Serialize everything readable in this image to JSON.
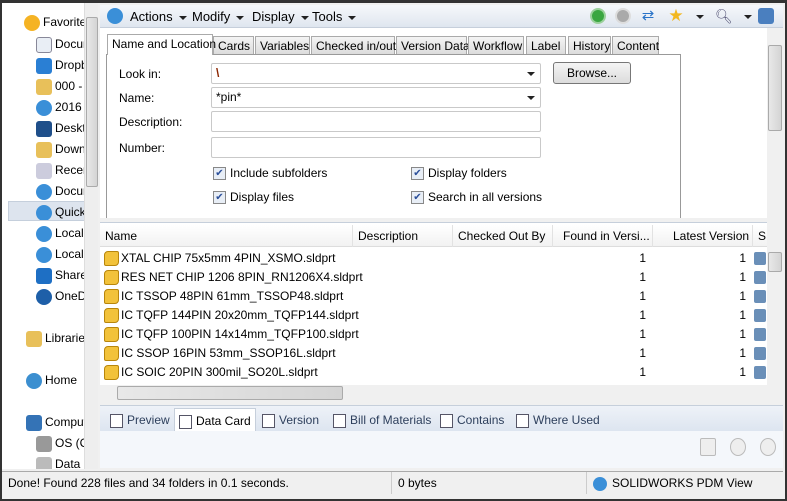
{
  "nav": {
    "items": [
      "Favorites",
      "Documents",
      "Dropbox",
      "000 -",
      "2016",
      "Desktop",
      "Downloads",
      "Recent",
      "Documents",
      "Quick",
      "Local",
      "Local",
      "SharePoint",
      "OneDrive",
      "Libraries",
      "Home",
      "Computer",
      "OS (C:)",
      "Data"
    ],
    "selected": "Quick"
  },
  "toolbar": {
    "menus": [
      "Actions",
      "Modify",
      "Display",
      "Tools"
    ],
    "icons": [
      "start-search-icon",
      "stop-search-icon",
      "refresh-icon",
      "favorites-star-icon",
      "search-zoom-icon",
      "pdm-help-icon"
    ]
  },
  "search": {
    "tabs": [
      "Name and Location",
      "Cards",
      "Variables",
      "Checked in/out",
      "Version Data",
      "Workflow",
      "Label",
      "History",
      "Content"
    ],
    "active_tab": "Name and Location",
    "look_in_label": "Look in:",
    "look_in_value": "\\",
    "name_label": "Name:",
    "name_value": "*pin*",
    "description_label": "Description:",
    "description_value": "",
    "number_label": "Number:",
    "number_value": "",
    "browse_label": "Browse...",
    "include_subfolders": {
      "label": "Include subfolders",
      "checked": true
    },
    "display_files": {
      "label": "Display files",
      "checked": true
    },
    "display_folders": {
      "label": "Display folders",
      "checked": true
    },
    "search_all_versions": {
      "label": "Search in all versions",
      "checked": true
    }
  },
  "list": {
    "columns": [
      "Name",
      "Description",
      "Checked Out By",
      "Found in Versi...",
      "Latest Version",
      "S"
    ],
    "rows": [
      {
        "name": "XTAL CHIP 75x5mm 4PIN_XSMO.sldprt",
        "found": "1",
        "latest": "1"
      },
      {
        "name": "RES NET CHIP 1206 8PIN_RN1206X4.sldprt",
        "found": "1",
        "latest": "1"
      },
      {
        "name": "IC TSSOP 48PIN 61mm_TSSOP48.sldprt",
        "found": "1",
        "latest": "1"
      },
      {
        "name": "IC TQFP 144PIN 20x20mm_TQFP144.sldprt",
        "found": "1",
        "latest": "1"
      },
      {
        "name": "IC TQFP 100PIN 14x14mm_TQFP100.sldprt",
        "found": "1",
        "latest": "1"
      },
      {
        "name": "IC SSOP 16PIN 53mm_SSOP16L.sldprt",
        "found": "1",
        "latest": "1"
      },
      {
        "name": "IC SOIC 20PIN 300mil_SO20L.sldprt",
        "found": "1",
        "latest": "1"
      }
    ]
  },
  "bottom_tabs": [
    "Preview",
    "Data Card",
    "Version",
    "Bill of Materials",
    "Contains",
    "Where Used"
  ],
  "bottom_active": "Data Card",
  "status": {
    "message": "Done! Found 228 files and 34 folders in 0.1 seconds.",
    "size": "0 bytes",
    "app": "SOLIDWORKS PDM View"
  }
}
